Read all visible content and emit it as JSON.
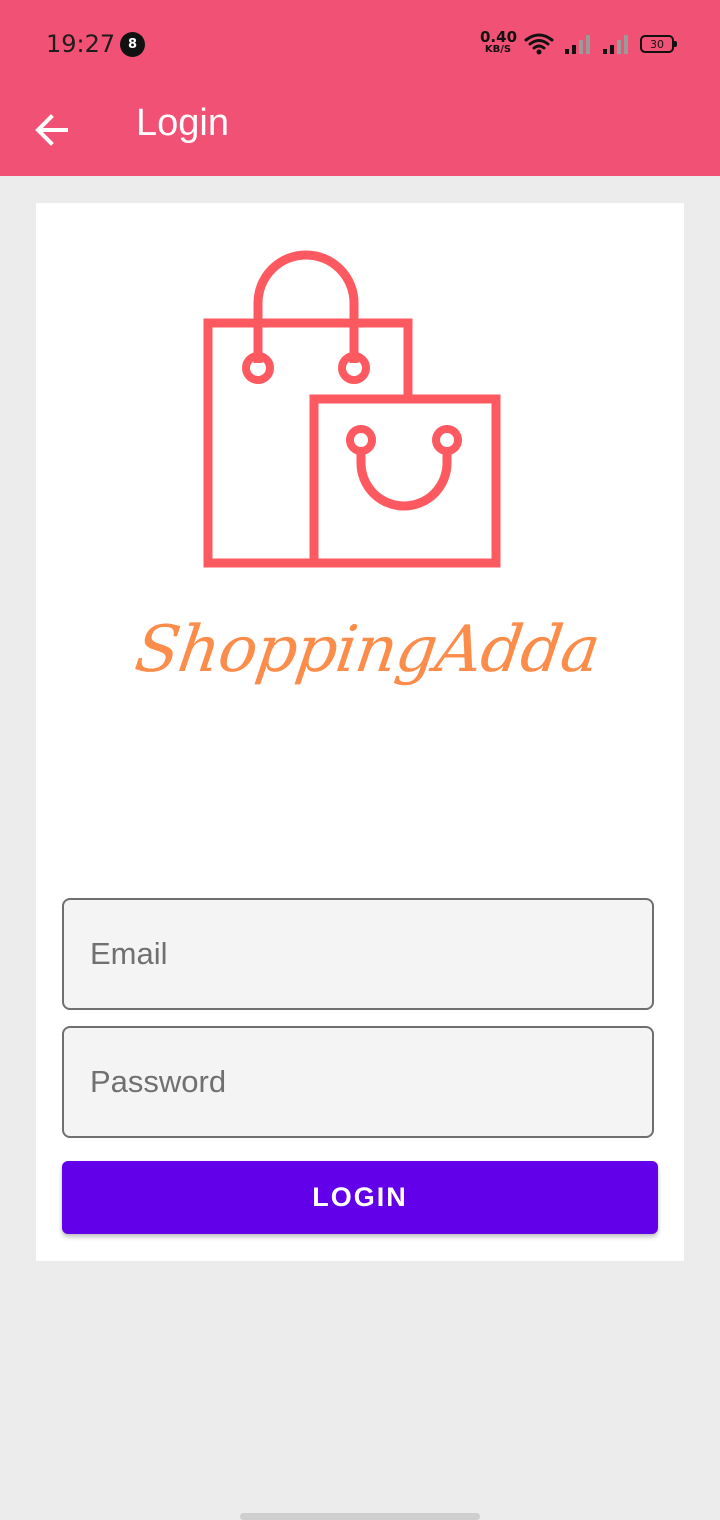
{
  "status_bar": {
    "time": "19:27",
    "notification_count": "8",
    "net_speed_value": "0.40",
    "net_speed_unit": "KB/S",
    "battery": "30",
    "icons": [
      "wifi-icon",
      "signal-icon",
      "signal-icon",
      "battery-icon"
    ]
  },
  "toolbar": {
    "title": "Login",
    "back_icon": "arrow-back-icon"
  },
  "logo": {
    "brand_name": "ShoppingAdda",
    "icon": "shopping-bags-icon"
  },
  "form": {
    "email_placeholder": "Email",
    "email_value": "",
    "password_placeholder": "Password",
    "password_value": "",
    "login_label": "LOGIN"
  },
  "colors": {
    "app_bar": "#f05174",
    "logo_bags": "#fc5a60",
    "logo_text": "#fb8c4a",
    "button": "#6200ea",
    "background": "#ececec"
  }
}
